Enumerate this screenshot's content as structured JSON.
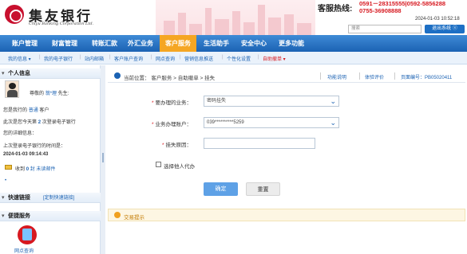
{
  "header": {
    "bank_name_cn": "集友银行",
    "bank_name_en": "Chiyu Banking Corporation Ltd.",
    "hotline_label": "客服热线:",
    "hotline_line1": "0591－28315555|0592-5856288",
    "hotline_line2": "0755-36908888",
    "search_placeholder": "搜索",
    "datetime": "2024-01-03 10:52:18",
    "logout_label": "退出系统 ⓧ"
  },
  "main_nav": [
    {
      "label": "账户管理"
    },
    {
      "label": "财富管理"
    },
    {
      "label": "转账汇款"
    },
    {
      "label": "外汇业务"
    },
    {
      "label": "客户服务"
    },
    {
      "label": "生活助手"
    },
    {
      "label": "安全中心"
    },
    {
      "label": "更多功能"
    }
  ],
  "sub_nav": [
    {
      "label": "我的信息 ▾"
    },
    {
      "label": "我的电子银行"
    },
    {
      "label": "站内邮箱"
    },
    {
      "label": "客户账户查询"
    },
    {
      "label": "网点查询"
    },
    {
      "label": "营销信息推送"
    },
    {
      "label": "个性化设置"
    },
    {
      "label": "自助撤单 ▾"
    }
  ],
  "sidebar": {
    "personal_info_title": "个人信息",
    "greeting_prefix": "尊敬的",
    "user_name": "翁*理",
    "greeting_suffix": "先生:",
    "level_prefix": "您是我行的",
    "level": "普通",
    "level_suffix": "客户",
    "login_count_prefix": "此次是您今天第",
    "login_count": "2",
    "login_count_suffix": "次登录电子银行",
    "detail_info": "您的详细信息：",
    "last_login_label": "上次登录电子银行的时间是：",
    "last_login_time": "2024-01-03 09:14:43",
    "mail_prefix": "收到",
    "mail_count": "0",
    "mail_suffix": "封 未读邮件",
    "dot": "•",
    "quick_links_title": "快速链接",
    "custom_quick_links": "[定制快速链接]",
    "convenience_title": "便捷服务",
    "branch_query": "网点查询"
  },
  "breadcrumb": {
    "label": "当前位置：",
    "path": "客户服务 > 自助撤单 > 挂失",
    "func_help": "功能说明",
    "service_rating": "体验评价",
    "page_code": "页面编号：PB05020411"
  },
  "form": {
    "business_label": "要办理的业务：",
    "business_value": "密码挂失",
    "account_label": "业务办理账户：",
    "account_value": "039**********5259",
    "reason_label": "挂失原因：",
    "reason_value": "",
    "agent_label": "选择他人代办",
    "confirm_label": "确定",
    "reset_label": "重置"
  },
  "tips": {
    "label": "交易提示"
  },
  "colors": {
    "brand_red": "#d71920",
    "nav_blue": "#1b62b3",
    "active_tab": "#f5a623",
    "confirm_blue": "#5ea1e6"
  }
}
